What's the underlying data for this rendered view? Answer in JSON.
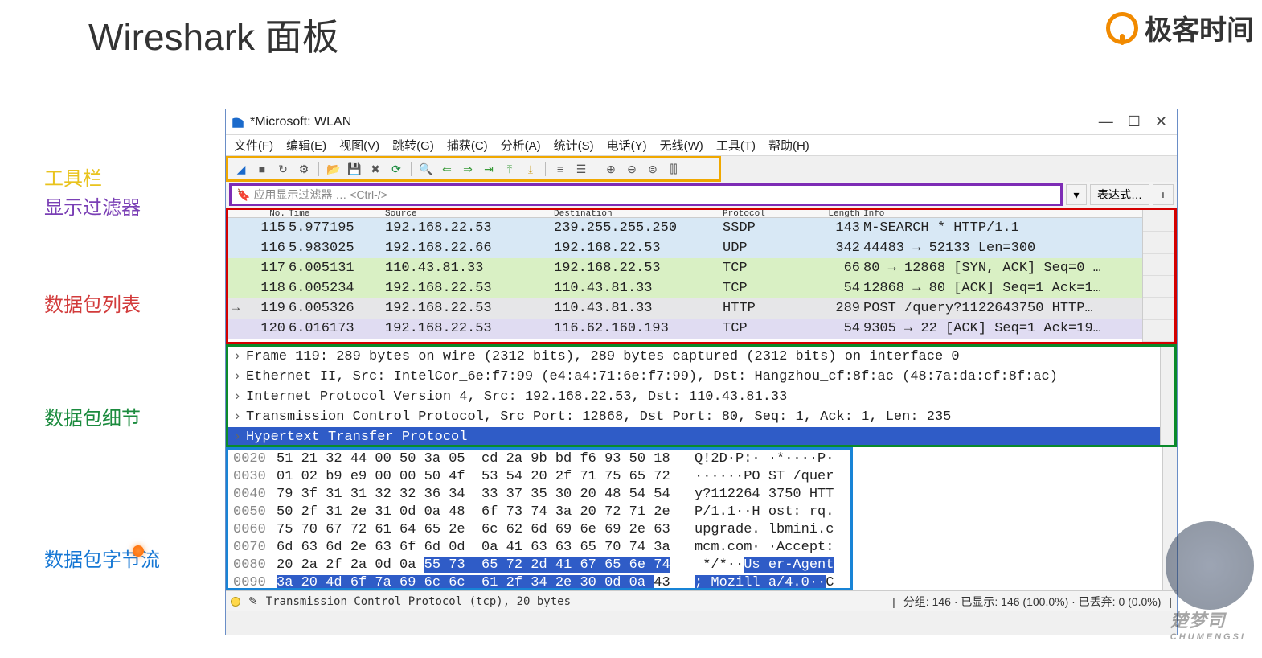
{
  "page": {
    "title": "Wireshark 面板",
    "brand": "极客时间"
  },
  "side_labels": {
    "toolbar": "工具栏",
    "filter": "显示过滤器",
    "packet_list": "数据包列表",
    "packet_detail": "数据包细节",
    "byte_stream": "数据包字节流"
  },
  "window": {
    "title": "*Microsoft: WLAN",
    "controls": {
      "min": "—",
      "max": "☐",
      "close": "✕"
    }
  },
  "menu": [
    "文件(F)",
    "编辑(E)",
    "视图(V)",
    "跳转(G)",
    "捕获(C)",
    "分析(A)",
    "统计(S)",
    "电话(Y)",
    "无线(W)",
    "工具(T)",
    "帮助(H)"
  ],
  "filter": {
    "placeholder": "应用显示过滤器 … <Ctrl-/>",
    "expression_btn": "表达式…",
    "plus": "+"
  },
  "columns": {
    "no": "No.",
    "time": "Time",
    "src": "Source",
    "dst": "Destination",
    "prot": "Protocol",
    "len": "Length",
    "info": "Info"
  },
  "packets": [
    {
      "no": "115",
      "time": "5.977195",
      "src": "192.168.22.53",
      "dst": "239.255.255.250",
      "prot": "SSDP",
      "len": "143",
      "info": "M-SEARCH * HTTP/1.1",
      "cls": "blue1"
    },
    {
      "no": "116",
      "time": "5.983025",
      "src": "192.168.22.66",
      "dst": "192.168.22.53",
      "prot": "UDP",
      "len": "342",
      "info": "44483 → 52133 Len=300",
      "cls": "blue1"
    },
    {
      "no": "117",
      "time": "6.005131",
      "src": "110.43.81.33",
      "dst": "192.168.22.53",
      "prot": "TCP",
      "len": "66",
      "info": "80 → 12868 [SYN, ACK] Seq=0 …",
      "cls": "green"
    },
    {
      "no": "118",
      "time": "6.005234",
      "src": "192.168.22.53",
      "dst": "110.43.81.33",
      "prot": "TCP",
      "len": "54",
      "info": "12868 → 80 [ACK] Seq=1 Ack=1…",
      "cls": "green"
    },
    {
      "no": "119",
      "time": "6.005326",
      "src": "192.168.22.53",
      "dst": "110.43.81.33",
      "prot": "HTTP",
      "len": "289",
      "info": "POST /query?1122643750 HTTP…",
      "cls": "gray",
      "arrow": true
    },
    {
      "no": "120",
      "time": "6.016173",
      "src": "192.168.22.53",
      "dst": "116.62.160.193",
      "prot": "TCP",
      "len": "54",
      "info": "9305 → 22 [ACK] Seq=1 Ack=19…",
      "cls": "lav"
    }
  ],
  "details": [
    {
      "text": "Frame 119: 289 bytes on wire (2312 bits), 289 bytes captured (2312 bits) on interface 0"
    },
    {
      "text": "Ethernet II, Src: IntelCor_6e:f7:99 (e4:a4:71:6e:f7:99), Dst: Hangzhou_cf:8f:ac (48:7a:da:cf:8f:ac)"
    },
    {
      "text": "Internet Protocol Version 4, Src: 192.168.22.53, Dst: 110.43.81.33"
    },
    {
      "text": "Transmission Control Protocol, Src Port: 12868, Dst Port: 80, Seq: 1, Ack: 1, Len: 235"
    },
    {
      "text": "Hypertext Transfer Protocol",
      "selected": true
    }
  ],
  "bytes": [
    {
      "off": "0020",
      "hex": "51 21 32 44 00 50 3a 05  cd 2a 9b bd f6 93 50 18",
      "asc": "Q!2D·P:· ·*····P·"
    },
    {
      "off": "0030",
      "hex": "01 02 b9 e9 00 00 50 4f  53 54 20 2f 71 75 65 72",
      "asc": "······PO ST /quer"
    },
    {
      "off": "0040",
      "hex": "79 3f 31 31 32 32 36 34  33 37 35 30 20 48 54 54",
      "asc": "y?112264 3750 HTT"
    },
    {
      "off": "0050",
      "hex": "50 2f 31 2e 31 0d 0a 48  6f 73 74 3a 20 72 71 2e",
      "asc": "P/1.1··H ost: rq."
    },
    {
      "off": "0060",
      "hex": "75 70 67 72 61 64 65 2e  6c 62 6d 69 6e 69 2e 63",
      "asc": "upgrade. lbmini.c"
    },
    {
      "off": "0070",
      "hex": "6d 63 6d 2e 63 6f 6d 0d  0a 41 63 63 65 70 74 3a",
      "asc": "mcm.com· ·Accept:"
    },
    {
      "off": "0080",
      "hex_pre": "20 2a 2f 2a 0d 0a ",
      "hex_hl": "55 73  65 72 2d 41 67 65 6e 74",
      "asc_pre": " */*··",
      "asc_hl": "Us er-Agent"
    },
    {
      "off": "0090",
      "hex_hl": "3a 20 4d 6f 7a 69 6c 6c  61 2f 34 2e 30 0d 0a ",
      "hex_post": "43",
      "asc_hl": "; Mozill a/4.0··",
      "asc_post": "C"
    }
  ],
  "status": {
    "text": "Transmission Control Protocol (tcp), 20 bytes",
    "stats": "分组: 146 · 已显示: 146 (100.0%) · 已丢弃: 0 (0.0%)"
  },
  "watermark": {
    "main": "楚梦司",
    "sub": "CHUMENGSI"
  }
}
